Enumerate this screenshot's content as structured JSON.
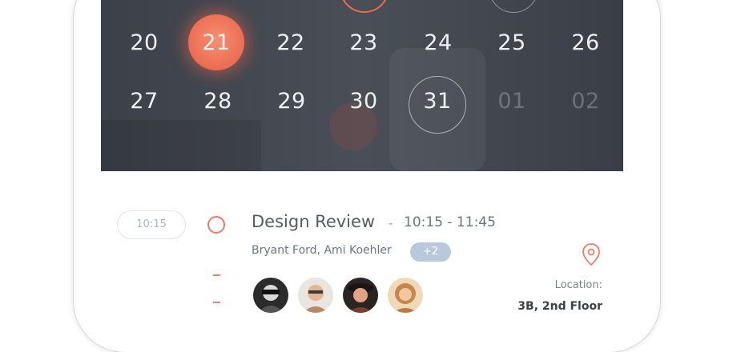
{
  "calendar": {
    "row1": [
      "20",
      "21",
      "22",
      "23",
      "24",
      "25",
      "26"
    ],
    "row2": [
      "27",
      "28",
      "29",
      "30",
      "31",
      "01",
      "02"
    ],
    "selected_day": "21",
    "outlined_day": "31",
    "accent_color": "#ec6c52"
  },
  "event": {
    "time_pill": "10:15",
    "title": "Design Review",
    "separator": "-",
    "time_range": "10:15 - 11:45",
    "attendees": "Bryant Ford, Ami Koehler",
    "more_count": "+2",
    "avatars": [
      "avatar-1",
      "avatar-2",
      "avatar-3",
      "avatar-4"
    ],
    "location_label": "Location:",
    "location_value": "3B, 2nd Floor",
    "location_icon": "map-pin-icon",
    "status_icon": "circle-ring-icon"
  }
}
